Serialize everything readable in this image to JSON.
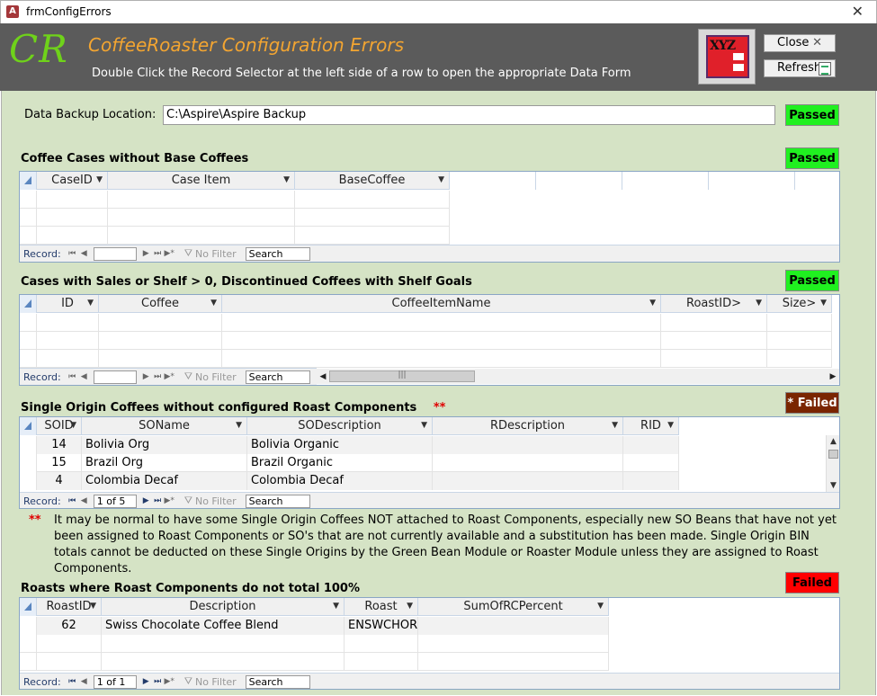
{
  "window": {
    "title": "frmConfigErrors",
    "close_glyph": "✕"
  },
  "header": {
    "logo": "CR",
    "title": "CoffeeRoaster Configuration Errors",
    "subtitle": "Double Click the Record Selector at the left side of a row to open the appropriate Data Form",
    "xyz_logo": "XYZ",
    "close_label": "Close",
    "refresh_label": "Refresh",
    "colors": {
      "bg": "#5b5b5b",
      "logo": "#6fd21a",
      "title": "#f3a531"
    }
  },
  "backup": {
    "label": "Data Backup Location:",
    "value": "C:\\Aspire\\Aspire Backup",
    "status": "Passed"
  },
  "nav_common": {
    "record_label": "Record:",
    "no_filter": "No Filter",
    "search": "Search",
    "first": "⏮",
    "prev": "◀",
    "next": "▶",
    "last": "⏭",
    "new": "▶*"
  },
  "sections": {
    "cases_no_base": {
      "title": "Coffee Cases without Base Coffees",
      "status": "Passed",
      "columns": [
        "CaseID",
        "Case Item",
        "BaseCoffee"
      ],
      "nav_pos": ""
    },
    "cases_sales": {
      "title": "Cases with Sales  or Shelf > 0, Discontinued Coffees with Shelf Goals",
      "status": "Passed",
      "columns": [
        "ID",
        "Coffee",
        "CoffeeItemName",
        "RoastID>",
        "Size>"
      ],
      "nav_pos": ""
    },
    "single_origin": {
      "title": "Single Origin Coffees without configured Roast Components",
      "stars": "**",
      "status": "* Failed",
      "columns": [
        "SOID",
        "SOName",
        "SODescription",
        "RDescription",
        "RID"
      ],
      "rows": [
        {
          "soid": "14",
          "soname": "Bolivia Org",
          "sodesc": "Bolivia Organic",
          "rdesc": "",
          "rid": ""
        },
        {
          "soid": "15",
          "soname": "Brazil Org",
          "sodesc": "Brazil Organic",
          "rdesc": "",
          "rid": ""
        },
        {
          "soid": "4",
          "soname": "Colombia Decaf",
          "sodesc": "Colombia Decaf",
          "rdesc": "",
          "rid": ""
        }
      ],
      "nav_pos": "1 of 5"
    },
    "note": {
      "stars": "**",
      "text": "It may be normal to have some Single Origin Coffees NOT attached to Roast Components, especially new SO Beans that have not yet been assigned to Roast Components or SO's that are not currently available and a substitution has been made.  Single Origin BIN totals cannot be deducted on these Single Origins by the Green Bean Module or Roaster Module unless they are assigned to Roast Components."
    },
    "roasts": {
      "title": "Roasts where Roast Components do not total 100%",
      "status": "Failed",
      "columns": [
        "RoastID",
        "Description",
        "Roast",
        "SumOfRCPercent"
      ],
      "rows": [
        {
          "roastid": "62",
          "description": "Swiss Chocolate Coffee Blend",
          "roast": "ENSWCHOR",
          "sum": ""
        }
      ],
      "nav_pos": "1 of 1"
    }
  }
}
